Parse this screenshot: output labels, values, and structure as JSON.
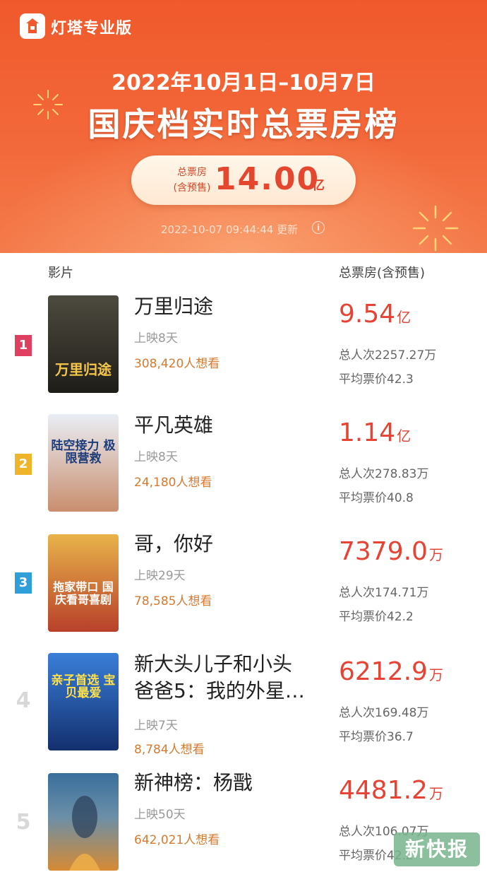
{
  "app": {
    "name": "灯塔专业版"
  },
  "header": {
    "date_range": "2022年10月1日–10月7日",
    "title": "国庆档实时总票房榜",
    "total_label_line1": "总票房",
    "total_label_line2": "(含预售)",
    "total_value": "14.00",
    "total_unit": "亿",
    "update_time": "2022-10-07 09:44:44 更新",
    "info_icon": "info-icon"
  },
  "columns": {
    "film": "影片",
    "box": "总票房(含预售)"
  },
  "films": [
    {
      "rank": "1",
      "rank_color": "#e04060",
      "title_line1": "万里归途",
      "title_line2": "",
      "days": "上映8天",
      "want": "308,420人想看",
      "box_value": "9.54",
      "box_unit": "亿",
      "viewers": "总人次2257.27万",
      "avg_price": "平均票价42.3",
      "poster_text": "万里归途",
      "poster_colors": [
        "#4d4b3f",
        "#1f1d18"
      ],
      "poster_text_color": "#f5c64a"
    },
    {
      "rank": "2",
      "rank_color": "#f0b42a",
      "title_line1": "平凡英雄",
      "title_line2": "",
      "days": "上映8天",
      "want": "24,180人想看",
      "box_value": "1.14",
      "box_unit": "亿",
      "viewers": "总人次278.83万",
      "avg_price": "平均票价40.8",
      "poster_text": "陆空接力 极限营救",
      "poster_colors": [
        "#e9eef5",
        "#c98e6e"
      ],
      "poster_text_color": "#1c3c7a"
    },
    {
      "rank": "3",
      "rank_color": "#2e9fd8",
      "title_line1": "哥，你好",
      "title_line2": "",
      "days": "上映29天",
      "want": "78,585人想看",
      "box_value": "7379.0",
      "box_unit": "万",
      "viewers": "总人次174.71万",
      "avg_price": "平均票价42.2",
      "poster_text": "拖家带口 国庆看哥喜剧",
      "poster_colors": [
        "#e8b34a",
        "#b8402a"
      ],
      "poster_text_color": "#ffffff"
    },
    {
      "rank": "4",
      "rank_color": "#d8d8d8",
      "title_line1": "新大头儿子和小头",
      "title_line2": "爸爸5：我的外星…",
      "days": "上映7天",
      "want": "8,784人想看",
      "box_value": "6212.9",
      "box_unit": "万",
      "viewers": "总人次169.48万",
      "avg_price": "平均票价36.7",
      "poster_text": "亲子首选 宝贝最爱",
      "poster_colors": [
        "#3a7fd8",
        "#132f6e"
      ],
      "poster_text_color": "#ffe04a"
    },
    {
      "rank": "5",
      "rank_color": "#d8d8d8",
      "title_line1": "新神榜：杨戬",
      "title_line2": "",
      "days": "上映50天",
      "want": "642,021人想看",
      "box_value": "4481.2",
      "box_unit": "万",
      "viewers": "总人次106.07万",
      "avg_price": "平均票价42.2",
      "poster_text": "",
      "poster_colors": [
        "#3a6f9c",
        "#d68a34"
      ],
      "poster_text_color": "#ffffff"
    }
  ],
  "watermark": "新快报"
}
